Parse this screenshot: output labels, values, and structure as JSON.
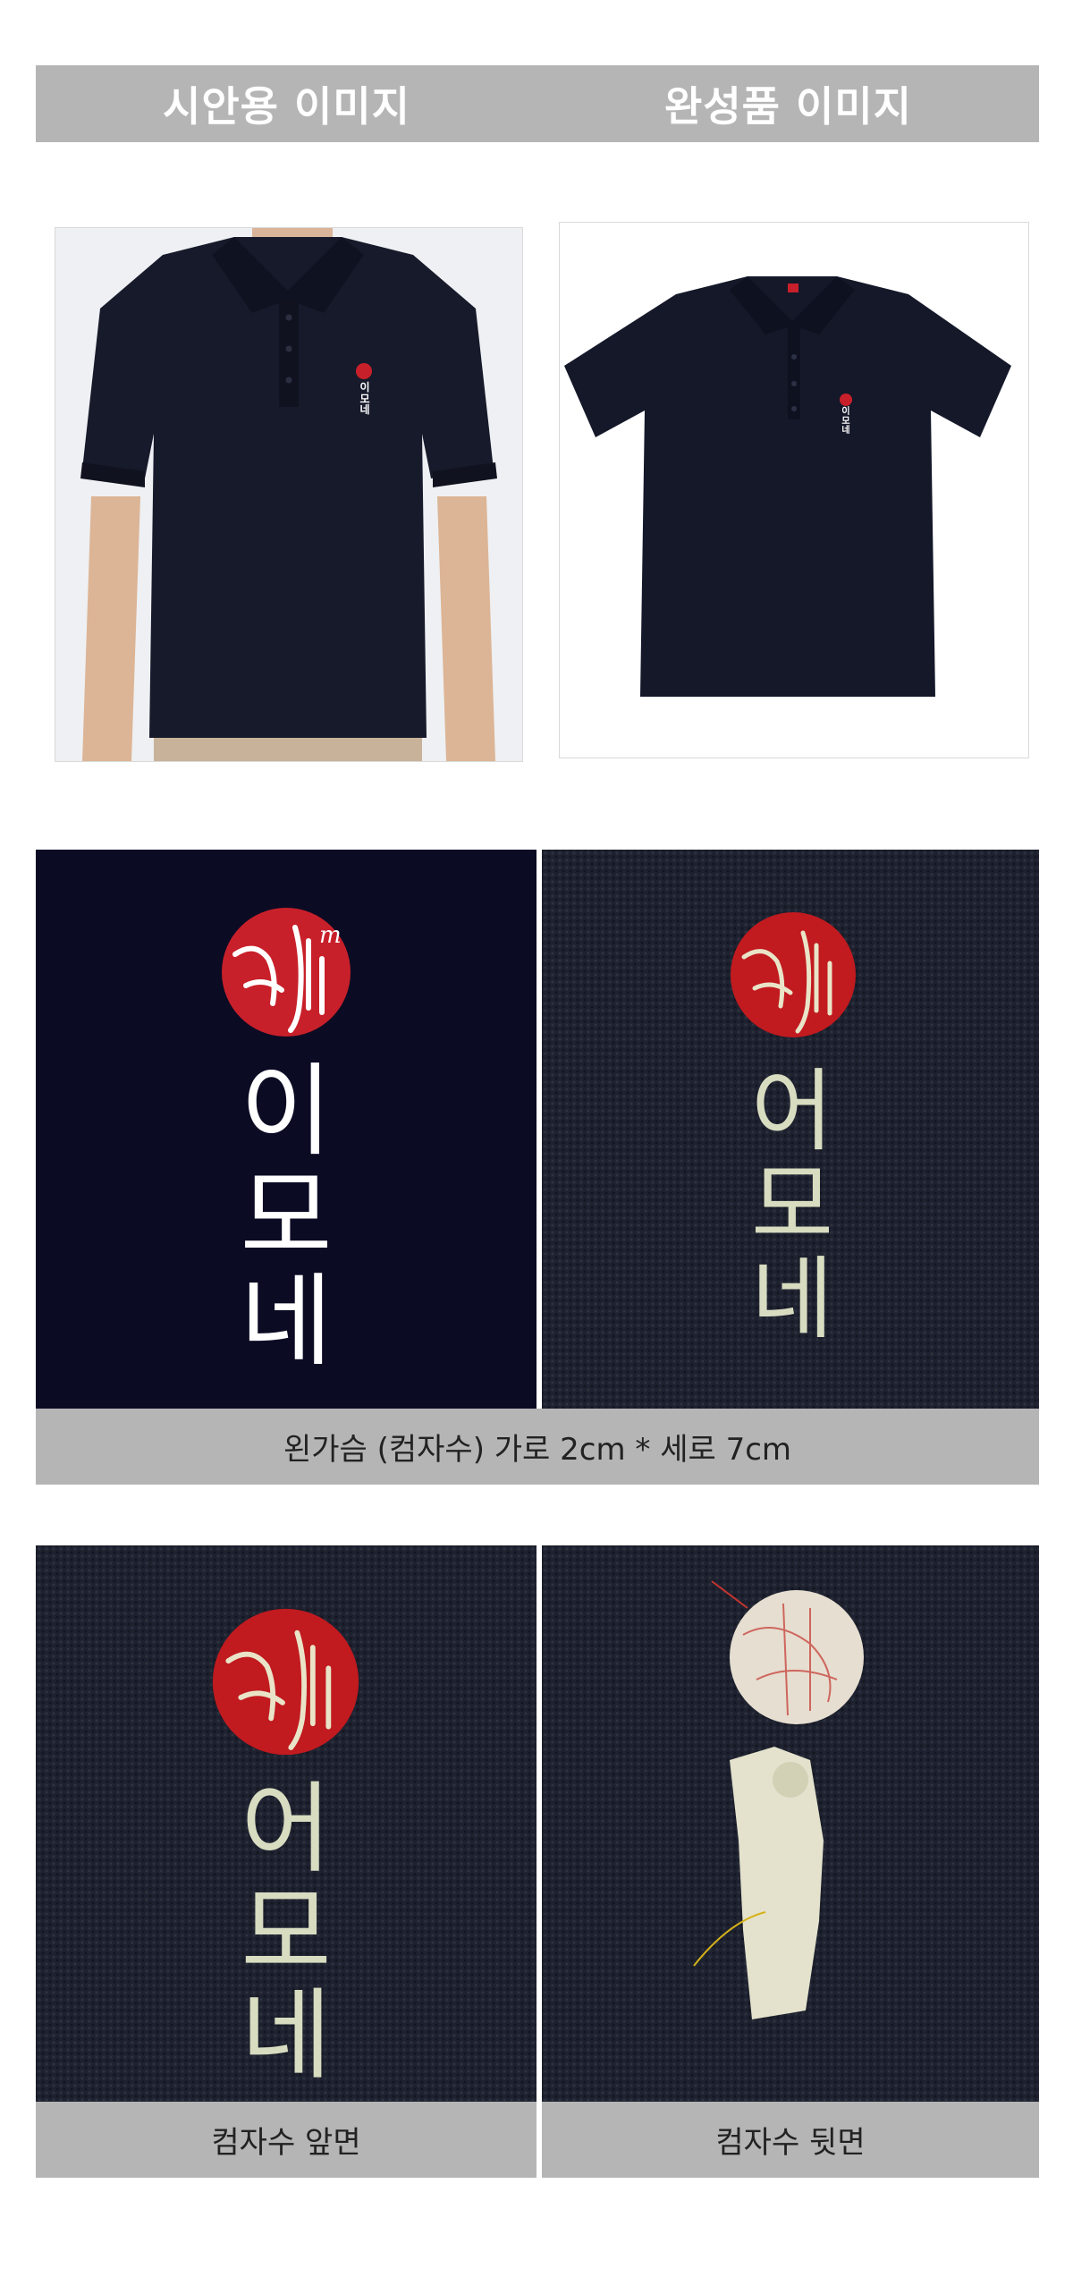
{
  "header": {
    "left_label": "시안용 이미지",
    "right_label": "완성품 이미지"
  },
  "shirt_logo": {
    "char1": "이",
    "char2": "모",
    "char3": "네"
  },
  "design_panel": {
    "char1": "이",
    "char2": "모",
    "char3": "네"
  },
  "embroidery_panel": {
    "char1": "어",
    "char2": "모",
    "char3": "네"
  },
  "caption_1": "왼가슴 (컴자수) 가로 2cm * 세로 7cm",
  "embroidery_front": {
    "char1": "어",
    "char2": "모",
    "char3": "네"
  },
  "caption_front": "컴자수 앞면",
  "caption_back": "컴자수 뒷면",
  "colors": {
    "bar_gray": "#b5b5b5",
    "logo_red": "#c8202a",
    "navy": "#1a1d2e",
    "thread": "#d8dcc0"
  }
}
